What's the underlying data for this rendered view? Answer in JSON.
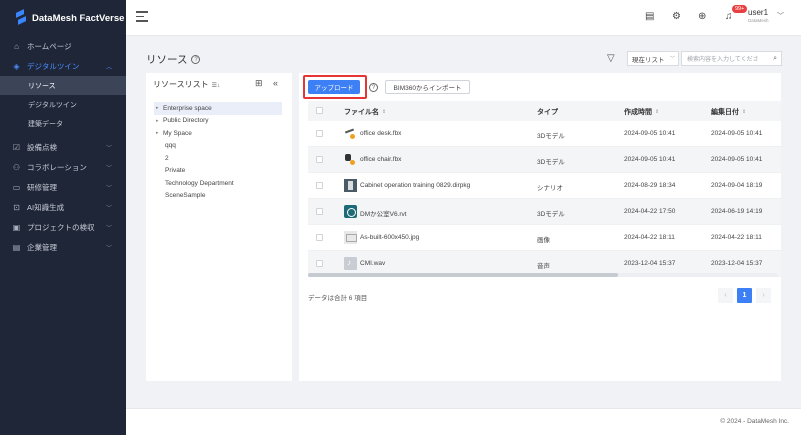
{
  "app": {
    "name": "DataMesh FactVerse"
  },
  "sidebar": {
    "items": [
      {
        "label": "ホームページ",
        "icon": "home-icon",
        "glyph": "⌂"
      },
      {
        "label": "デジタルツイン",
        "icon": "cube-icon",
        "glyph": "◈"
      },
      {
        "label": "設備点検",
        "icon": "checklist-icon",
        "glyph": "☑"
      },
      {
        "label": "コラボレーション",
        "icon": "people-icon",
        "glyph": "⚇"
      },
      {
        "label": "研修管理",
        "icon": "book-icon",
        "glyph": "▭"
      },
      {
        "label": "AI知識生成",
        "icon": "ai-icon",
        "glyph": "⊡"
      },
      {
        "label": "プロジェクトの検収",
        "icon": "project-icon",
        "glyph": "▣"
      },
      {
        "label": "企業管理",
        "icon": "enterprise-icon",
        "glyph": "▤"
      }
    ],
    "sub_items": [
      "リソース",
      "デジタルツイン",
      "建築データ"
    ]
  },
  "header": {
    "badge": "99+",
    "username": "user1",
    "user_sub": "DataMesh"
  },
  "page": {
    "title": "リソース",
    "select_value": "現在リスト",
    "search_placeholder": "検索内容を入力してくださ"
  },
  "left_panel": {
    "title": "リソースリスト",
    "tree": [
      {
        "label": "Enterprise space",
        "expandable": true,
        "selected": true
      },
      {
        "label": "Public Directory",
        "expandable": true
      },
      {
        "label": "My Space",
        "expandable": true
      },
      {
        "label": "qqq"
      },
      {
        "label": "2"
      },
      {
        "label": "Private"
      },
      {
        "label": "Technology Department"
      },
      {
        "label": "SceneSample"
      }
    ]
  },
  "toolbar": {
    "upload_label": "アップロード",
    "import_label": "BIM360からインポート"
  },
  "table": {
    "columns": [
      "ファイル名",
      "タイプ",
      "作成時間",
      "編集日付"
    ],
    "rows": [
      {
        "name": "office desk.fbx",
        "type": "3Dモデル",
        "created": "2024-09-05 10:41",
        "edited": "2024-09-05 10:41",
        "thumb": "desk"
      },
      {
        "name": "office chair.fbx",
        "type": "3Dモデル",
        "created": "2024-09-05 10:41",
        "edited": "2024-09-05 10:41",
        "thumb": "chair"
      },
      {
        "name": "Cabinet operation training 0829.dirpkg",
        "type": "シナリオ",
        "created": "2024-08-29 18:34",
        "edited": "2024-09-04 18:19",
        "thumb": "cab"
      },
      {
        "name": "DMか公室V6.rvt",
        "type": "3Dモデル",
        "created": "2024-04-22 17:50",
        "edited": "2024-06-19 14:19",
        "thumb": "rvt"
      },
      {
        "name": "As-built-600x450.jpg",
        "type": "画像",
        "created": "2024-04-22 18:11",
        "edited": "2024-04-22 18:11",
        "thumb": "jpg"
      },
      {
        "name": "CMI.wav",
        "type": "音声",
        "created": "2023-12-04 15:37",
        "edited": "2023-12-04 15:37",
        "thumb": "wav"
      }
    ]
  },
  "pagination": {
    "total_text": "データは合計 6 項目",
    "current": "1"
  },
  "footer": {
    "copyright": "© 2024 - DataMesh Inc."
  }
}
